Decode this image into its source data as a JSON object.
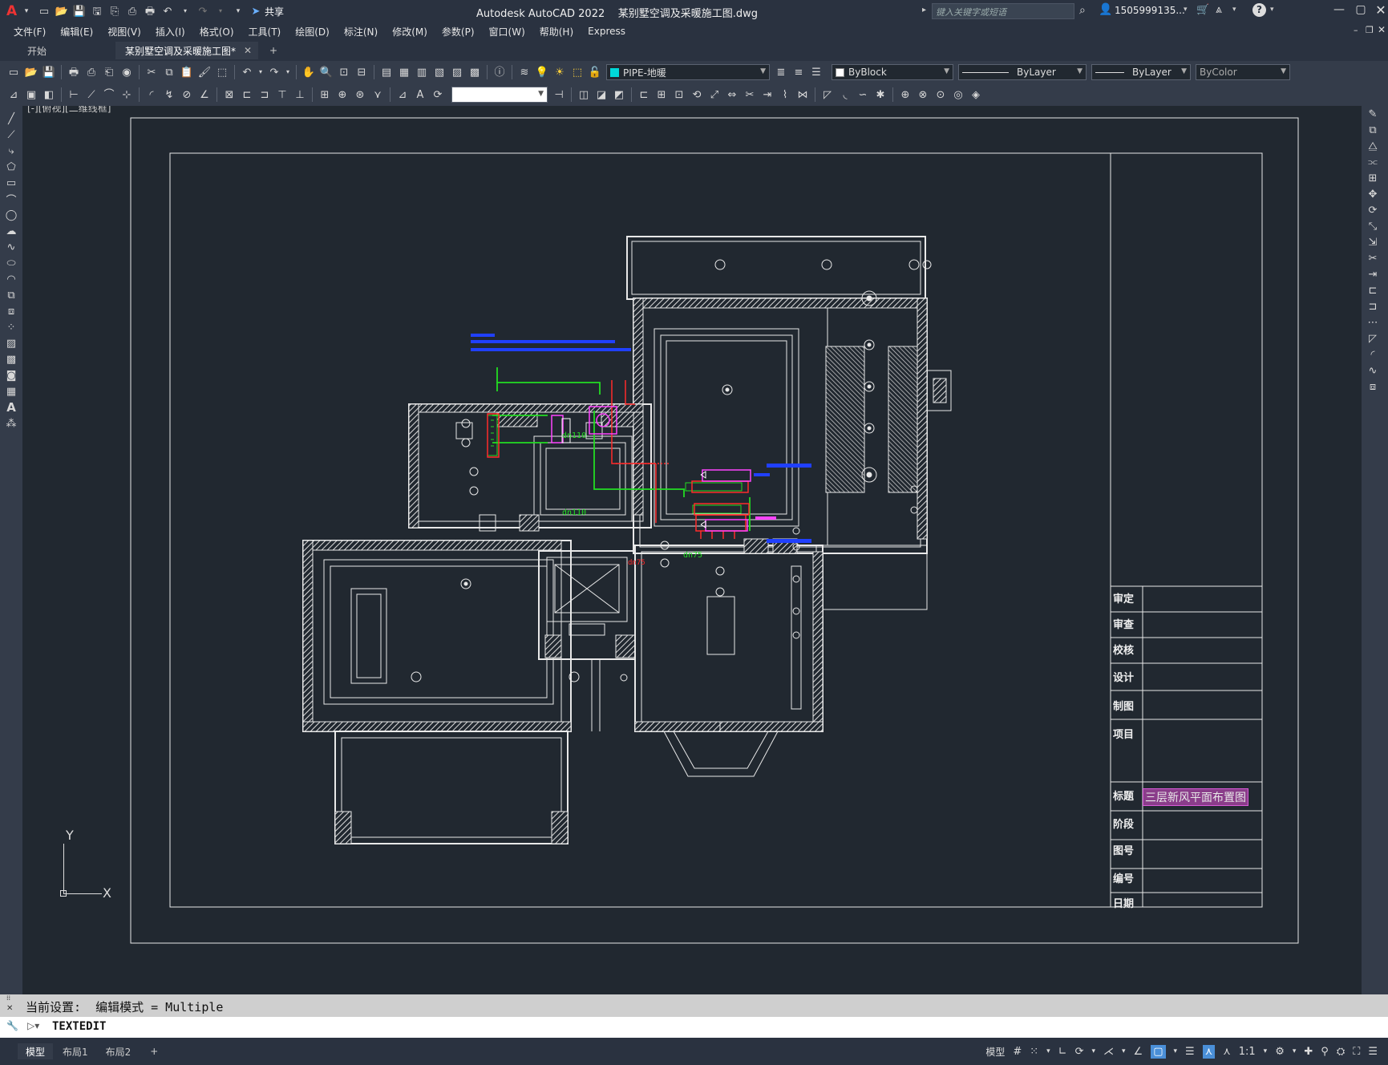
{
  "titlebar": {
    "app_letter": "A",
    "share_label": "共享",
    "title": "Autodesk AutoCAD 2022    某别墅空调及采暖施工图.dwg",
    "search_placeholder": "键入关键字或短语",
    "user": "1505999135...",
    "help_icon": "?"
  },
  "menu": [
    "文件(F)",
    "编辑(E)",
    "视图(V)",
    "插入(I)",
    "格式(O)",
    "工具(T)",
    "绘图(D)",
    "标注(N)",
    "修改(M)",
    "参数(P)",
    "窗口(W)",
    "帮助(H)",
    "Express"
  ],
  "tabs": {
    "start": "开始",
    "doc": "某别墅空调及采暖施工图*",
    "new_tab": "+"
  },
  "toolbar": {
    "layer_value": "PIPE-地暖",
    "color_value": "ByBlock",
    "linetype_value": "ByLayer",
    "lineweight_value": "ByLayer",
    "plotstyle_value": "ByColor"
  },
  "viewport_label": "[-][俯视][二维线框]",
  "drawing": {
    "ucs_y": "Y",
    "ucs_x": "X",
    "title_rows": [
      "审定",
      "审查",
      "校核",
      "设计",
      "制图",
      "项目",
      "标题",
      "阶段",
      "图号",
      "编号",
      "日期"
    ],
    "sheet_title": "三层新风平面布置图",
    "dims": [
      "dn110",
      "dn110",
      "dn75",
      "dn75"
    ]
  },
  "command": {
    "history": "当前设置:  编辑模式 = Multiple",
    "current": "TEXTEDIT"
  },
  "status": {
    "tabs": [
      "模型",
      "布局1",
      "布局2"
    ],
    "add_tab": "+",
    "model_label": "模型",
    "scale": "1:1"
  },
  "colors": {
    "bg": "#212830",
    "panel": "#2a3240",
    "accent": "#4a8fd8",
    "red": "#ff2a2a",
    "green": "#22dd22",
    "blue": "#2040ff",
    "magenta": "#ff44ff"
  }
}
